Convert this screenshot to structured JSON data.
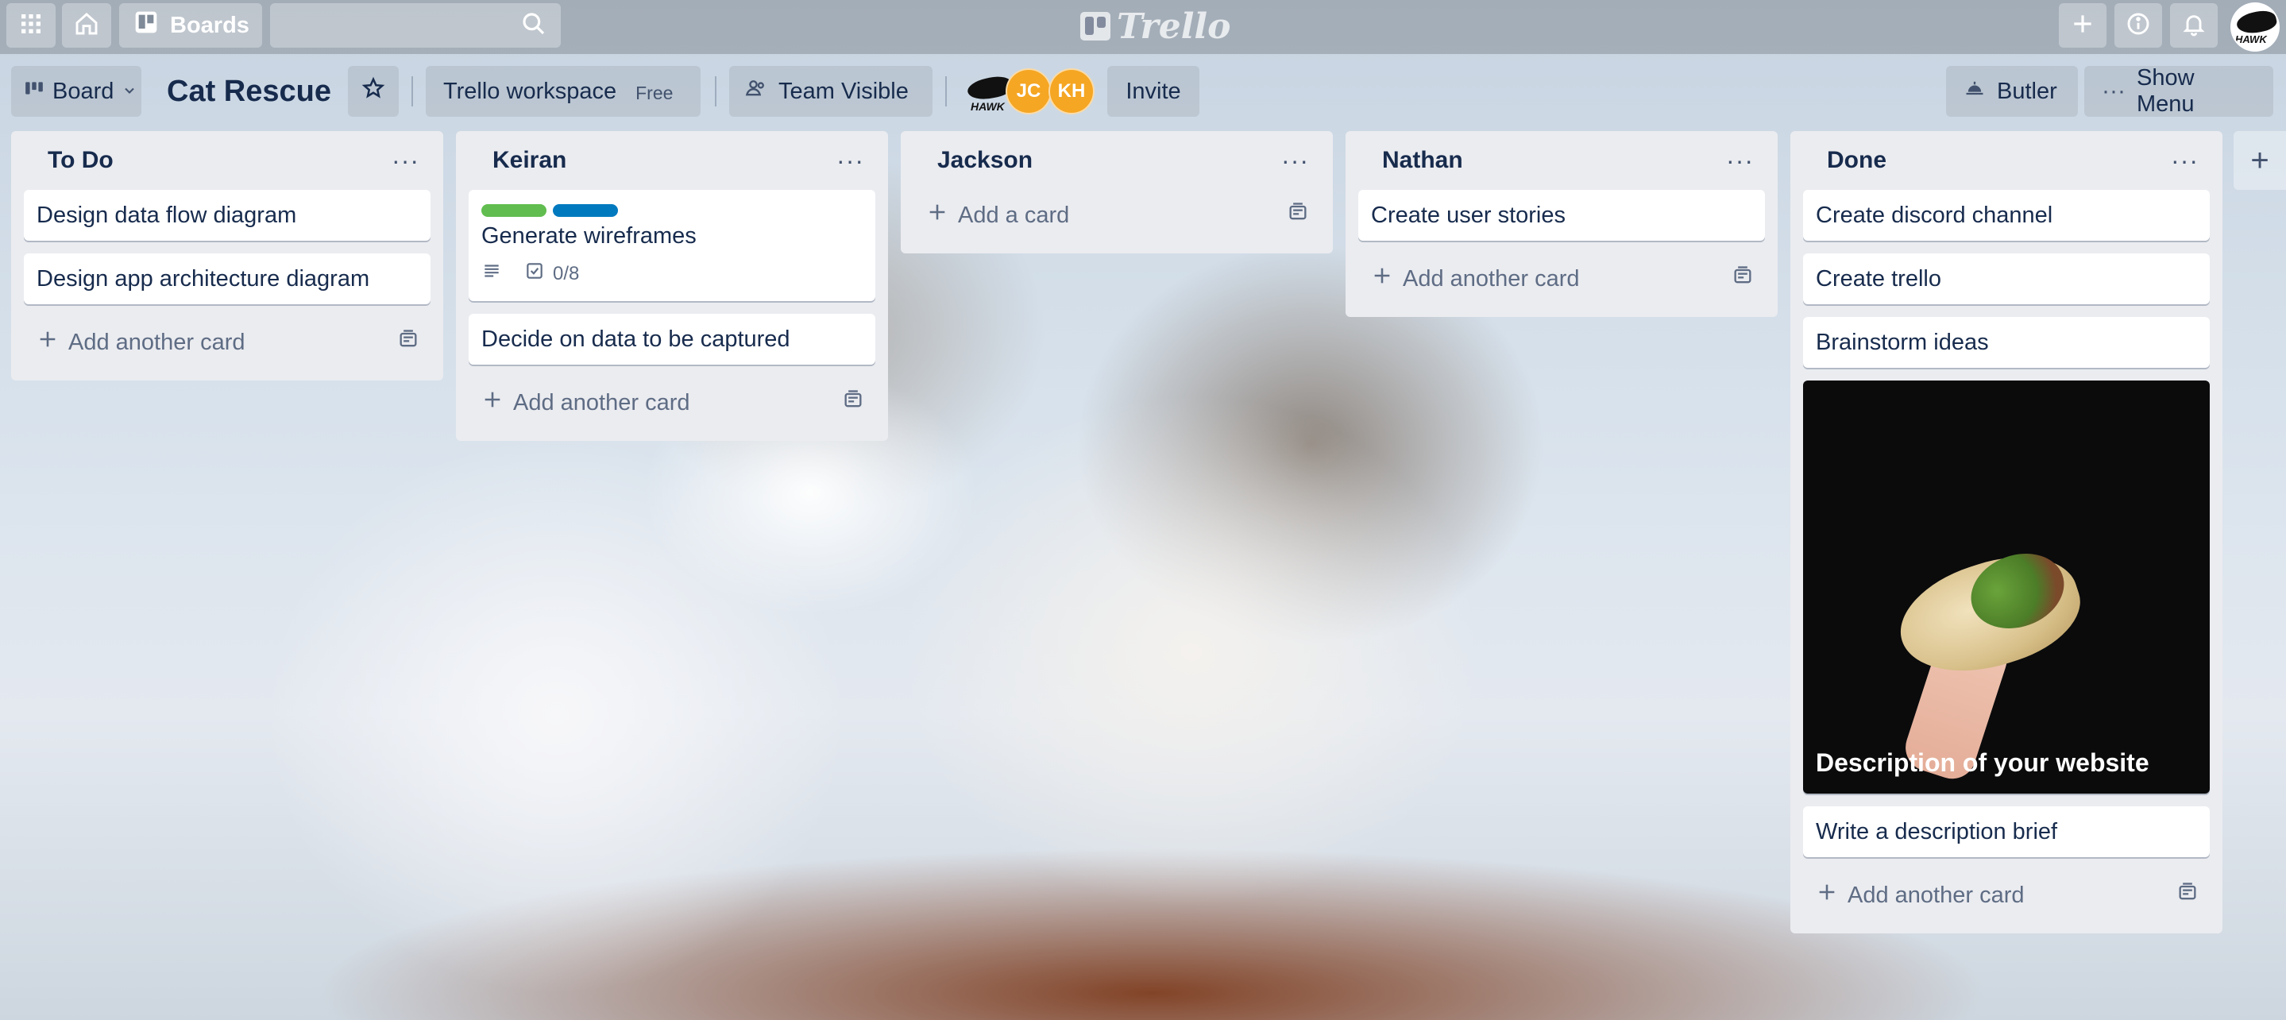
{
  "header": {
    "boards_label": "Boards",
    "logo_text": "Trello"
  },
  "board": {
    "view_label": "Board",
    "title": "Cat Rescue",
    "workspace_label": "Trello workspace",
    "plan_badge": "Free",
    "visibility_label": "Team Visible",
    "members": [
      {
        "initials": "",
        "name": "hawk",
        "color": "#ffffff"
      },
      {
        "initials": "JC",
        "color": "#f5a623"
      },
      {
        "initials": "KH",
        "color": "#f5a623"
      }
    ],
    "invite_label": "Invite",
    "butler_label": "Butler",
    "menu_label": "Show Menu"
  },
  "user_avatar_text": "HAWK",
  "lists": [
    {
      "title": "To Do",
      "cards": [
        "Design data flow diagram",
        "Design app architecture diagram"
      ],
      "add_label": "Add another card"
    },
    {
      "title": "Keiran",
      "labeled_card": {
        "title": "Generate wireframes",
        "label_colors": [
          "#61bd4f",
          "#0079bf"
        ],
        "checklist": "0/8"
      },
      "cards": [
        "Decide on data to be captured"
      ],
      "add_label": "Add another card"
    },
    {
      "title": "Jackson",
      "cards": [],
      "add_label": "Add a card"
    },
    {
      "title": "Nathan",
      "cards": [
        "Create user stories"
      ],
      "add_label": "Add another card"
    },
    {
      "title": "Done",
      "cards": [
        "Create discord channel",
        "Create trello",
        "Brainstorm ideas"
      ],
      "cover_card": "Description of your website",
      "last_card": "Write a description brief",
      "add_label": "Add another card"
    }
  ],
  "colors": {
    "list_bg": "#ebecf0",
    "member_orange": "#f5a623",
    "label_green": "#61bd4f",
    "label_blue": "#0079bf"
  }
}
